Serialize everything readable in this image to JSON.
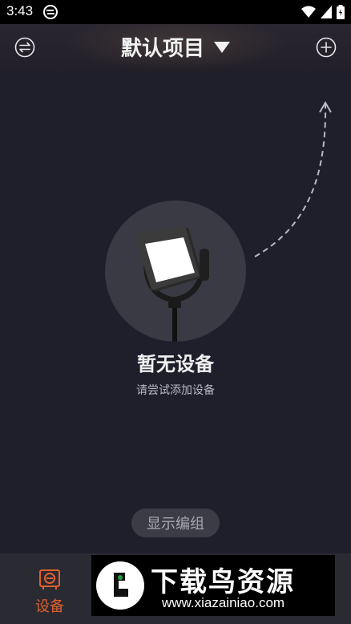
{
  "status_bar": {
    "time": "3:43"
  },
  "header": {
    "project_title": "默认项目"
  },
  "empty_state": {
    "title": "暂无设备",
    "subtitle": "请尝试添加设备"
  },
  "actions": {
    "group_button_label": "显示编组"
  },
  "tabbar": {
    "device_tab_label": "设备"
  },
  "watermark": {
    "title": "下载鸟资源",
    "url": "www.xiazainiao.com"
  },
  "colors": {
    "accent": "#e0612e",
    "background": "#1f1f2c"
  },
  "icons": [
    "switch-icon",
    "add-icon",
    "dropdown-caret-icon",
    "device-tab-icon",
    "wifi-icon",
    "signal-icon",
    "battery-icon"
  ]
}
